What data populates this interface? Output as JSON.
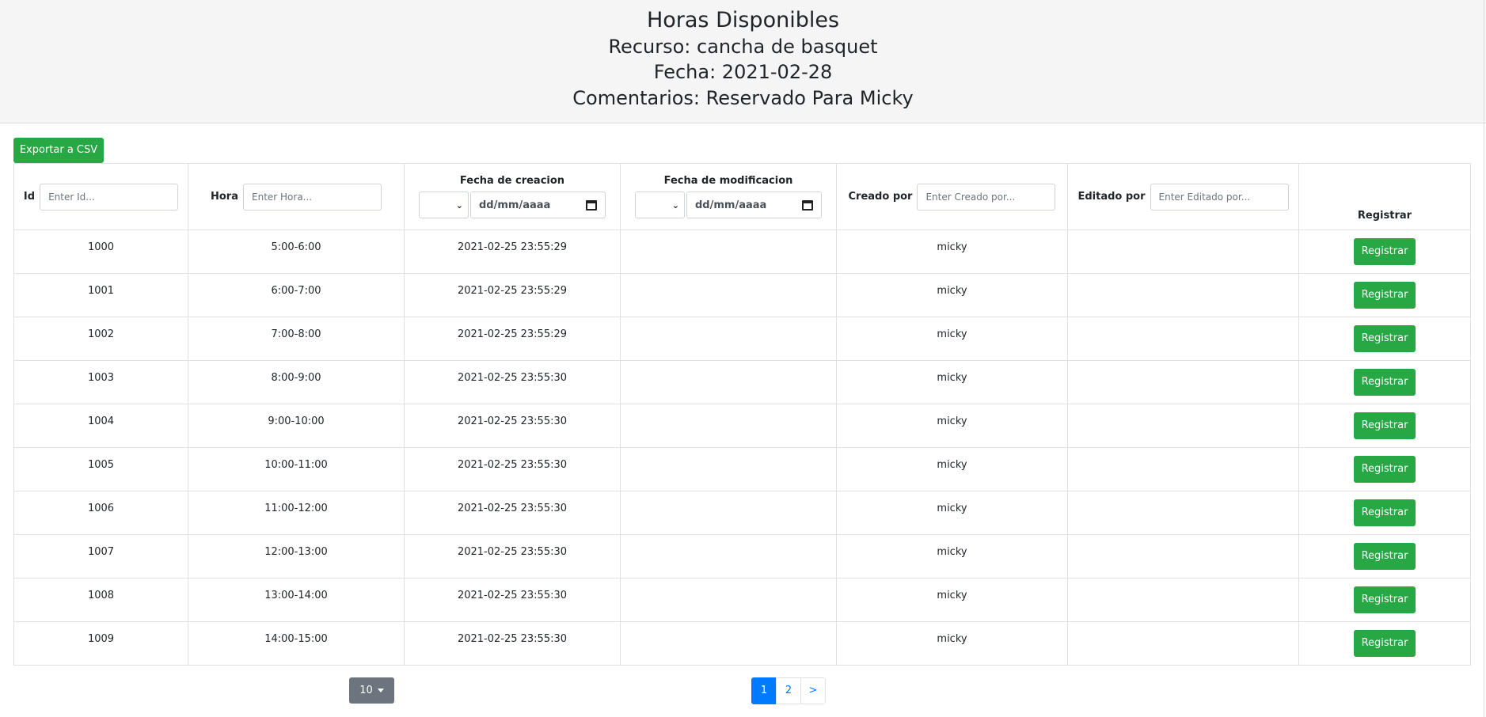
{
  "header": {
    "title": "Horas Disponibles",
    "recurso": "Recurso: cancha de basquet",
    "fecha": "Fecha: 2021-02-28",
    "comentarios": "Comentarios: Reservado Para Micky"
  },
  "toolbar": {
    "export_label": "Exportar a CSV"
  },
  "columns": {
    "id": {
      "label": "Id",
      "placeholder": "Enter Id..."
    },
    "hora": {
      "label": "Hora",
      "placeholder": "Enter Hora..."
    },
    "fecha_creacion": {
      "label": "Fecha de creacion",
      "date_placeholder": "dd/mm/aaaa"
    },
    "fecha_modificacion": {
      "label": "Fecha de modificacion",
      "date_placeholder": "dd/mm/aaaa"
    },
    "creado_por": {
      "label": "Creado por",
      "placeholder": "Enter Creado por..."
    },
    "editado_por": {
      "label": "Editado por",
      "placeholder": "Enter Editado por..."
    },
    "registrar": {
      "label": "Registrar"
    }
  },
  "rows": [
    {
      "id": "1000",
      "hora": "5:00-6:00",
      "creacion": "2021-02-25 23:55:29",
      "modificacion": "",
      "creado_por": "micky",
      "editado_por": "",
      "action": "Registrar"
    },
    {
      "id": "1001",
      "hora": "6:00-7:00",
      "creacion": "2021-02-25 23:55:29",
      "modificacion": "",
      "creado_por": "micky",
      "editado_por": "",
      "action": "Registrar"
    },
    {
      "id": "1002",
      "hora": "7:00-8:00",
      "creacion": "2021-02-25 23:55:29",
      "modificacion": "",
      "creado_por": "micky",
      "editado_por": "",
      "action": "Registrar"
    },
    {
      "id": "1003",
      "hora": "8:00-9:00",
      "creacion": "2021-02-25 23:55:30",
      "modificacion": "",
      "creado_por": "micky",
      "editado_por": "",
      "action": "Registrar"
    },
    {
      "id": "1004",
      "hora": "9:00-10:00",
      "creacion": "2021-02-25 23:55:30",
      "modificacion": "",
      "creado_por": "micky",
      "editado_por": "",
      "action": "Registrar"
    },
    {
      "id": "1005",
      "hora": "10:00-11:00",
      "creacion": "2021-02-25 23:55:30",
      "modificacion": "",
      "creado_por": "micky",
      "editado_por": "",
      "action": "Registrar"
    },
    {
      "id": "1006",
      "hora": "11:00-12:00",
      "creacion": "2021-02-25 23:55:30",
      "modificacion": "",
      "creado_por": "micky",
      "editado_por": "",
      "action": "Registrar"
    },
    {
      "id": "1007",
      "hora": "12:00-13:00",
      "creacion": "2021-02-25 23:55:30",
      "modificacion": "",
      "creado_por": "micky",
      "editado_por": "",
      "action": "Registrar"
    },
    {
      "id": "1008",
      "hora": "13:00-14:00",
      "creacion": "2021-02-25 23:55:30",
      "modificacion": "",
      "creado_por": "micky",
      "editado_por": "",
      "action": "Registrar"
    },
    {
      "id": "1009",
      "hora": "14:00-15:00",
      "creacion": "2021-02-25 23:55:30",
      "modificacion": "",
      "creado_por": "micky",
      "editado_por": "",
      "action": "Registrar"
    }
  ],
  "footer": {
    "page_size": "10",
    "pages": [
      "1",
      "2"
    ],
    "next_label": ">",
    "active_page": "1"
  },
  "colors": {
    "success": "#28a745",
    "primary": "#007bff",
    "secondary": "#6c757d",
    "header_bg": "#f5f5f5"
  }
}
